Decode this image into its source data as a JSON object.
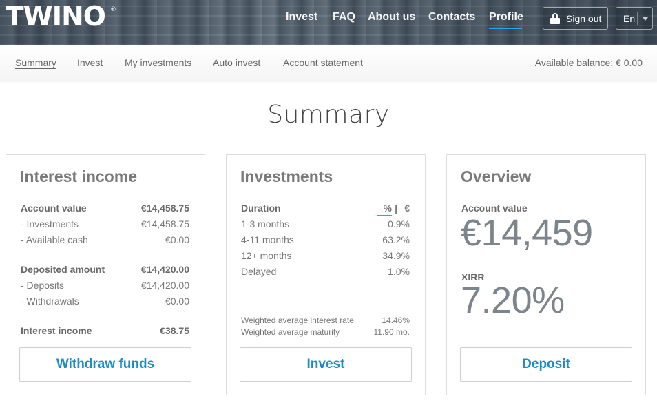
{
  "header": {
    "logo": "TWINO",
    "logo_mark": "®",
    "nav": [
      "Invest",
      "FAQ",
      "About us",
      "Contacts",
      "Profile"
    ],
    "active_nav": "Profile",
    "sign_out": "Sign out",
    "language": "En"
  },
  "subnav": {
    "items": [
      "Summary",
      "Invest",
      "My investments",
      "Auto invest",
      "Account statement"
    ],
    "active": "Summary",
    "balance": "Available balance: € 0.00"
  },
  "page_title": "Summary",
  "interest_card": {
    "title": "Interest income",
    "rows": [
      {
        "label": "Account value",
        "value": "€14,458.75"
      },
      {
        "label": "- Investments",
        "value": "€14,458.75"
      },
      {
        "label": "- Available cash",
        "value": "€0.00"
      },
      {
        "label": "Deposited amount",
        "value": "€14,420.00"
      },
      {
        "label": "- Deposits",
        "value": "€14,420.00"
      },
      {
        "label": "- Withdrawals",
        "value": "€0.00"
      },
      {
        "label": "Interest income",
        "value": "€38.75"
      }
    ],
    "button": "Withdraw funds"
  },
  "investments_card": {
    "title": "Investments",
    "duration_header": "Duration",
    "toggle": {
      "percent": "%",
      "separator": "|",
      "euro": "€"
    },
    "rows": [
      {
        "label": "1-3 months",
        "value": "0.9%"
      },
      {
        "label": "4-11 months",
        "value": "63.2%"
      },
      {
        "label": "12+ months",
        "value": "34.9%"
      },
      {
        "label": "Delayed",
        "value": "1.0%"
      }
    ],
    "stats": [
      {
        "label": "Weighted average interest rate",
        "value": "14.46%"
      },
      {
        "label": "Weighted average maturity",
        "value": "11.90 mo."
      }
    ],
    "button": "Invest"
  },
  "overview_card": {
    "title": "Overview",
    "account_value_label": "Account value",
    "account_value": "€14,459",
    "xirr_label": "XIRR",
    "xirr_value": "7.20%",
    "button": "Deposit"
  }
}
